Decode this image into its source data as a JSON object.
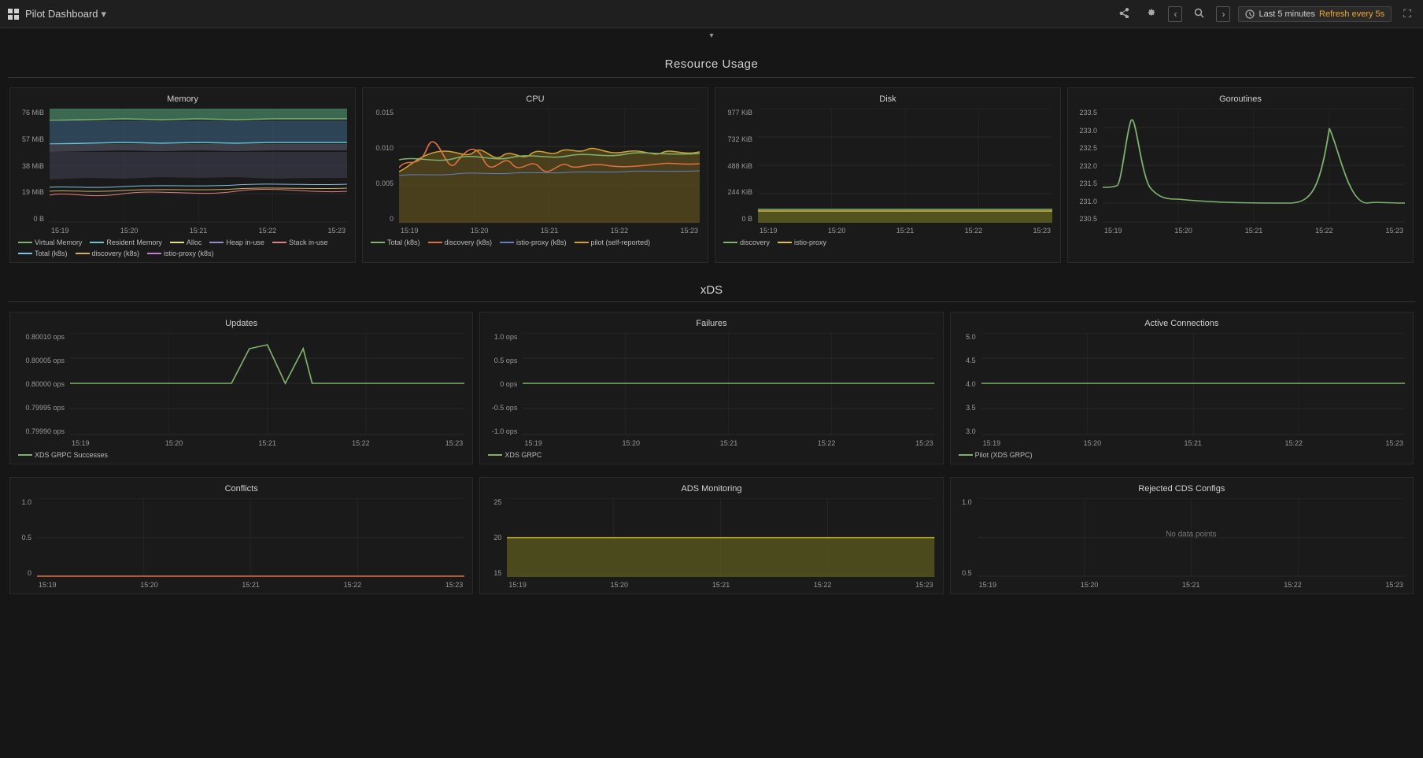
{
  "topnav": {
    "logo_label": "grid-icon",
    "title": "Pilot Dashboard",
    "dropdown_arrow": "▾",
    "share_icon": "⬆",
    "settings_icon": "⚙",
    "nav_prev": "‹",
    "search_icon": "🔍",
    "nav_next": "›",
    "time_icon": "🕐",
    "time_range": "Last 5 minutes",
    "refresh_text": "Refresh every 5s",
    "zoom_icon": "⊕"
  },
  "resource_section": {
    "title": "Resource Usage",
    "collapse_arrow": "▾"
  },
  "memory_panel": {
    "title": "Memory",
    "y_labels": [
      "76 MiB",
      "57 MiB",
      "38 MiB",
      "19 MiB",
      "0 B"
    ],
    "x_labels": [
      "15:19",
      "15:20",
      "15:21",
      "15:22",
      "15:23"
    ],
    "legend": [
      {
        "label": "Virtual Memory",
        "color": "#7eb26d"
      },
      {
        "label": "Resident Memory",
        "color": "#6ac4d4"
      },
      {
        "label": "Alloc",
        "color": "#e0e0a0"
      },
      {
        "label": "Heap in-use",
        "color": "#a0a0d0"
      },
      {
        "label": "Stack in-use",
        "color": "#e08080"
      },
      {
        "label": "Total (k8s)",
        "color": "#80c0e0"
      },
      {
        "label": "discovery (k8s)",
        "color": "#d0b060"
      },
      {
        "label": "istio-proxy (k8s)",
        "color": "#c080d0"
      }
    ]
  },
  "cpu_panel": {
    "title": "CPU",
    "y_labels": [
      "0.015",
      "0.010",
      "0.005",
      "0"
    ],
    "x_labels": [
      "15:19",
      "15:20",
      "15:21",
      "15:22",
      "15:23"
    ],
    "legend": [
      {
        "label": "Total (k8s)",
        "color": "#7eb26d"
      },
      {
        "label": "discovery (k8s)",
        "color": "#e07040"
      },
      {
        "label": "istio-proxy (k8s)",
        "color": "#6080c0"
      },
      {
        "label": "pilot (self-reported)",
        "color": "#d0a030"
      }
    ]
  },
  "disk_panel": {
    "title": "Disk",
    "y_labels": [
      "977 KiB",
      "732 KiB",
      "488 KiB",
      "244 KiB",
      "0 B"
    ],
    "x_labels": [
      "15:19",
      "15:20",
      "15:21",
      "15:22",
      "15:23"
    ],
    "legend": [
      {
        "label": "discovery",
        "color": "#7eb26d"
      },
      {
        "label": "istio-proxy",
        "color": "#e0c040"
      }
    ]
  },
  "goroutines_panel": {
    "title": "Goroutines",
    "y_labels": [
      "233.5",
      "233.0",
      "232.5",
      "232.0",
      "231.5",
      "231.0",
      "230.5"
    ],
    "x_labels": [
      "15:19",
      "15:20",
      "15:21",
      "15:22",
      "15:23"
    ],
    "legend": []
  },
  "xds_section": {
    "title": "xDS"
  },
  "updates_panel": {
    "title": "Updates",
    "y_labels": [
      "0.80010 ops",
      "0.80005 ops",
      "0.80000 ops",
      "0.79995 ops",
      "0.79990 ops"
    ],
    "x_labels": [
      "15:19",
      "15:20",
      "15:21",
      "15:22",
      "15:23"
    ],
    "legend": [
      {
        "label": "XDS GRPC Successes",
        "color": "#7eb26d"
      }
    ]
  },
  "failures_panel": {
    "title": "Failures",
    "y_labels": [
      "1.0 ops",
      "0.5 ops",
      "0 ops",
      "-0.5 ops",
      "-1.0 ops"
    ],
    "x_labels": [
      "15:19",
      "15:20",
      "15:21",
      "15:22",
      "15:23"
    ],
    "legend": [
      {
        "label": "XDS GRPC",
        "color": "#7eb26d"
      }
    ]
  },
  "active_connections_panel": {
    "title": "Active Connections",
    "y_labels": [
      "5.0",
      "4.5",
      "4.0",
      "3.5",
      "3.0"
    ],
    "x_labels": [
      "15:19",
      "15:20",
      "15:21",
      "15:22",
      "15:23"
    ],
    "legend": [
      {
        "label": "Pilot (XDS GRPC)",
        "color": "#7eb26d"
      }
    ]
  },
  "conflicts_panel": {
    "title": "Conflicts",
    "y_labels": [
      "1.0",
      "0.5",
      "0"
    ],
    "x_labels": [
      "15:19",
      "15:20",
      "15:21",
      "15:22",
      "15:23"
    ],
    "legend": []
  },
  "ads_monitoring_panel": {
    "title": "ADS Monitoring",
    "y_labels": [
      "25",
      "20",
      "15"
    ],
    "x_labels": [
      "15:19",
      "15:20",
      "15:21",
      "15:22",
      "15:23"
    ],
    "legend": []
  },
  "rejected_cds_panel": {
    "title": "Rejected CDS Configs",
    "y_labels": [
      "1.0",
      "0.5"
    ],
    "x_labels": [
      "15:19",
      "15:20",
      "15:21",
      "15:22",
      "15:23"
    ],
    "no_data": "No data points"
  }
}
